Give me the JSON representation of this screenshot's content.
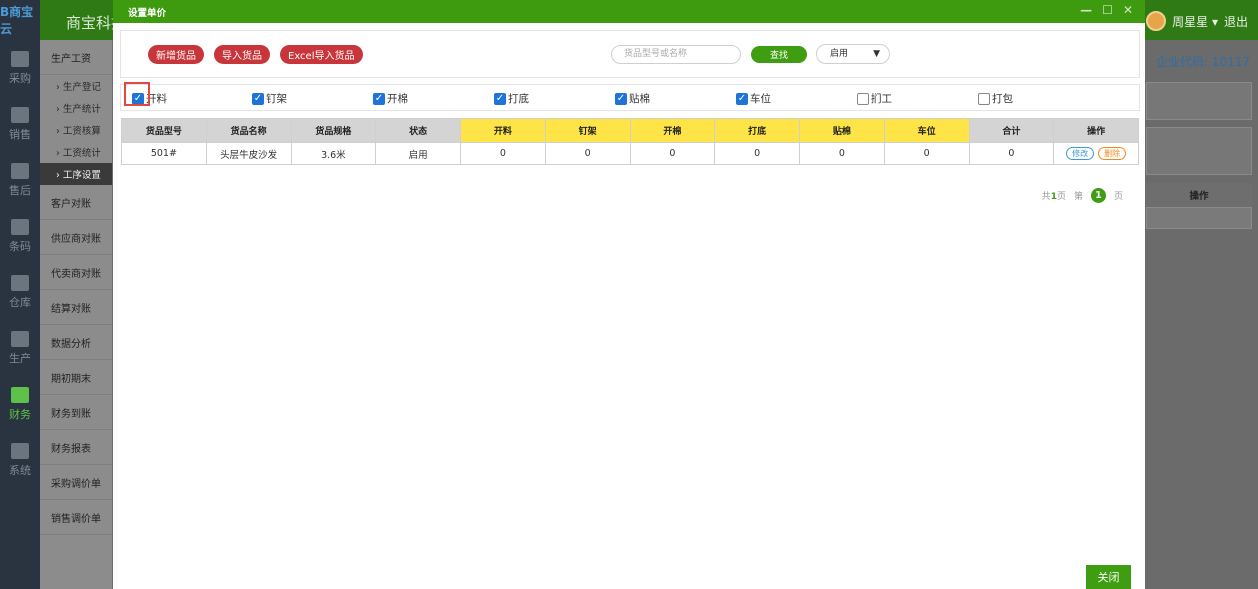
{
  "app": {
    "logo_text": "B商宝云",
    "brand": "商宝科技",
    "user_name": "周星星 ▾",
    "logout": "退出",
    "company_code": "企业代码: 10117",
    "bg_table_header": "操作"
  },
  "rail": [
    {
      "label": "采购",
      "icon": "purchase-icon"
    },
    {
      "label": "销售",
      "icon": "sales-icon"
    },
    {
      "label": "售后",
      "icon": "aftersale-icon"
    },
    {
      "label": "条码",
      "icon": "barcode-icon"
    },
    {
      "label": "仓库",
      "icon": "warehouse-icon"
    },
    {
      "label": "生产",
      "icon": "production-icon"
    },
    {
      "label": "财务",
      "icon": "finance-icon"
    },
    {
      "label": "系统",
      "icon": "settings-icon"
    }
  ],
  "submenu": {
    "group": "生产工资",
    "subs": [
      "› 生产登记",
      "› 生产统计",
      "› 工资核算",
      "› 工资统计",
      "› 工序设置"
    ],
    "items": [
      "客户对账",
      "供应商对账",
      "代卖商对账",
      "结算对账",
      "数据分析",
      "期初期末",
      "财务到账",
      "财务报表",
      "采购调价单",
      "销售调价单"
    ]
  },
  "modal": {
    "title": "设置单价",
    "controls": {
      "minimize": "—",
      "maximize": "☐",
      "close": "✕"
    },
    "buttons": {
      "add": "新增货品",
      "import": "导入货品",
      "excel": "Excel导入货品",
      "search": "查找",
      "close": "关闭"
    },
    "search_placeholder": "货品型号或名称",
    "status_select": "启用",
    "status_arrow": "▼",
    "checks": [
      {
        "label": "开料",
        "checked": true
      },
      {
        "label": "钉架",
        "checked": true
      },
      {
        "label": "开棉",
        "checked": true
      },
      {
        "label": "打底",
        "checked": true
      },
      {
        "label": "贴棉",
        "checked": true
      },
      {
        "label": "车位",
        "checked": true
      },
      {
        "label": "扪工",
        "checked": false
      },
      {
        "label": "打包",
        "checked": false
      }
    ],
    "table": {
      "headers": [
        "货品型号",
        "货品名称",
        "货品规格",
        "状态",
        "开料",
        "钉架",
        "开棉",
        "打底",
        "贴棉",
        "车位",
        "合计",
        "操作"
      ],
      "rows": [
        {
          "model": "501#",
          "name": "头层牛皮沙发",
          "spec": "3.6米",
          "status": "启用",
          "v1": "0",
          "v2": "0",
          "v3": "0",
          "v4": "0",
          "v5": "0",
          "v6": "0",
          "total": "0",
          "edit": "修改",
          "del": "删除"
        }
      ]
    },
    "pager": {
      "total_prefix": "共",
      "total_pages": "1",
      "total_suffix": "页",
      "page_prefix": "第",
      "current": "1",
      "page_suffix": "页"
    }
  }
}
